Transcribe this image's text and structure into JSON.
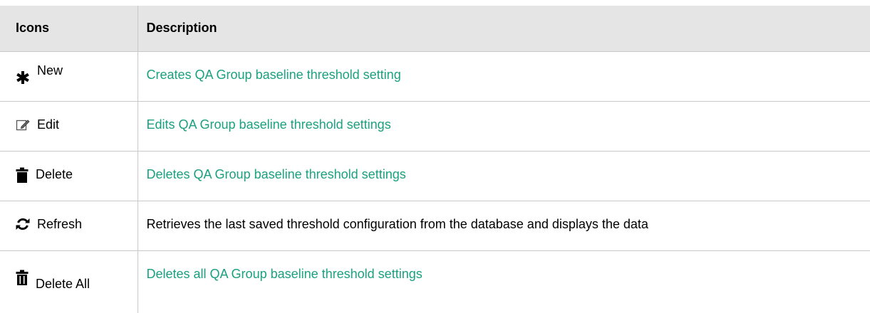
{
  "table": {
    "headers": {
      "icons": "Icons",
      "description": "Description"
    },
    "rows": [
      {
        "icon": "asterisk-icon",
        "label": "New",
        "description": "Creates QA Group baseline threshold setting",
        "is_link": true
      },
      {
        "icon": "edit-icon",
        "label": "Edit",
        "description": "Edits QA Group baseline threshold settings",
        "is_link": true
      },
      {
        "icon": "trash-icon",
        "label": "Delete",
        "description": "Deletes QA Group baseline threshold settings",
        "is_link": true
      },
      {
        "icon": "refresh-icon",
        "label": "Refresh",
        "description": "Retrieves the last saved threshold configuration from the database and displays the data",
        "is_link": false
      },
      {
        "icon": "trash-all-icon",
        "label": "Delete All",
        "description": "Deletes all QA Group baseline threshold settings",
        "is_link": true
      }
    ]
  },
  "colors": {
    "link": "#1aa07f",
    "header_bg": "#e5e5e5",
    "border": "#c8c8c8"
  }
}
